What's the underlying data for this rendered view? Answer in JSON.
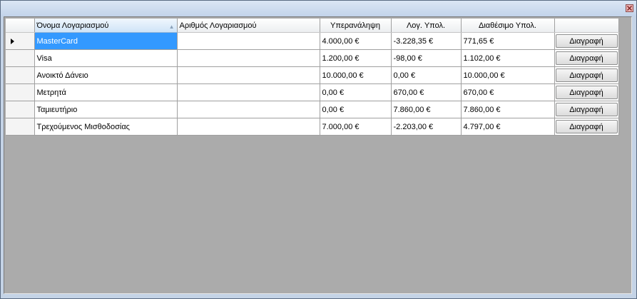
{
  "window": {
    "close_icon": "close-icon",
    "accent": "#c4d3e6",
    "close_color": "#efb3b3"
  },
  "grid": {
    "columns": [
      {
        "key": "name",
        "label": "Όνομα Λογαριασμού",
        "sorted": "ascending"
      },
      {
        "key": "number",
        "label": "Αριθμός Λογαριασμού"
      },
      {
        "key": "overdraft",
        "label": "Υπερανάληψη"
      },
      {
        "key": "ledger",
        "label": "Λογ. Υπολ."
      },
      {
        "key": "available",
        "label": "Διαθέσιμο Υπολ."
      },
      {
        "key": "action",
        "label": ""
      }
    ],
    "current_row": 0,
    "selection_color": "#3399ff",
    "rows": [
      {
        "name": "MasterCard",
        "number": "",
        "overdraft": "4.000,00 €",
        "ledger": "-3.228,35 €",
        "available": "771,65 €",
        "action": "Διαγραφή"
      },
      {
        "name": "Visa",
        "number": "",
        "overdraft": "1.200,00 €",
        "ledger": "-98,00 €",
        "available": "1.102,00 €",
        "action": "Διαγραφή"
      },
      {
        "name": "Ανοικτό Δάνειο",
        "number": "",
        "overdraft": "10.000,00 €",
        "ledger": "0,00 €",
        "available": "10.000,00 €",
        "action": "Διαγραφή"
      },
      {
        "name": "Μετρητά",
        "number": "",
        "overdraft": "0,00 €",
        "ledger": "670,00 €",
        "available": "670,00 €",
        "action": "Διαγραφή"
      },
      {
        "name": "Ταμιευτήριο",
        "number": "",
        "overdraft": "0,00 €",
        "ledger": "7.860,00 €",
        "available": "7.860,00 €",
        "action": "Διαγραφή"
      },
      {
        "name": "Τρεχούμενος Μισθοδοσίας",
        "number": "",
        "overdraft": "7.000,00 €",
        "ledger": "-2.203,00 €",
        "available": "4.797,00 €",
        "action": "Διαγραφή"
      }
    ]
  }
}
